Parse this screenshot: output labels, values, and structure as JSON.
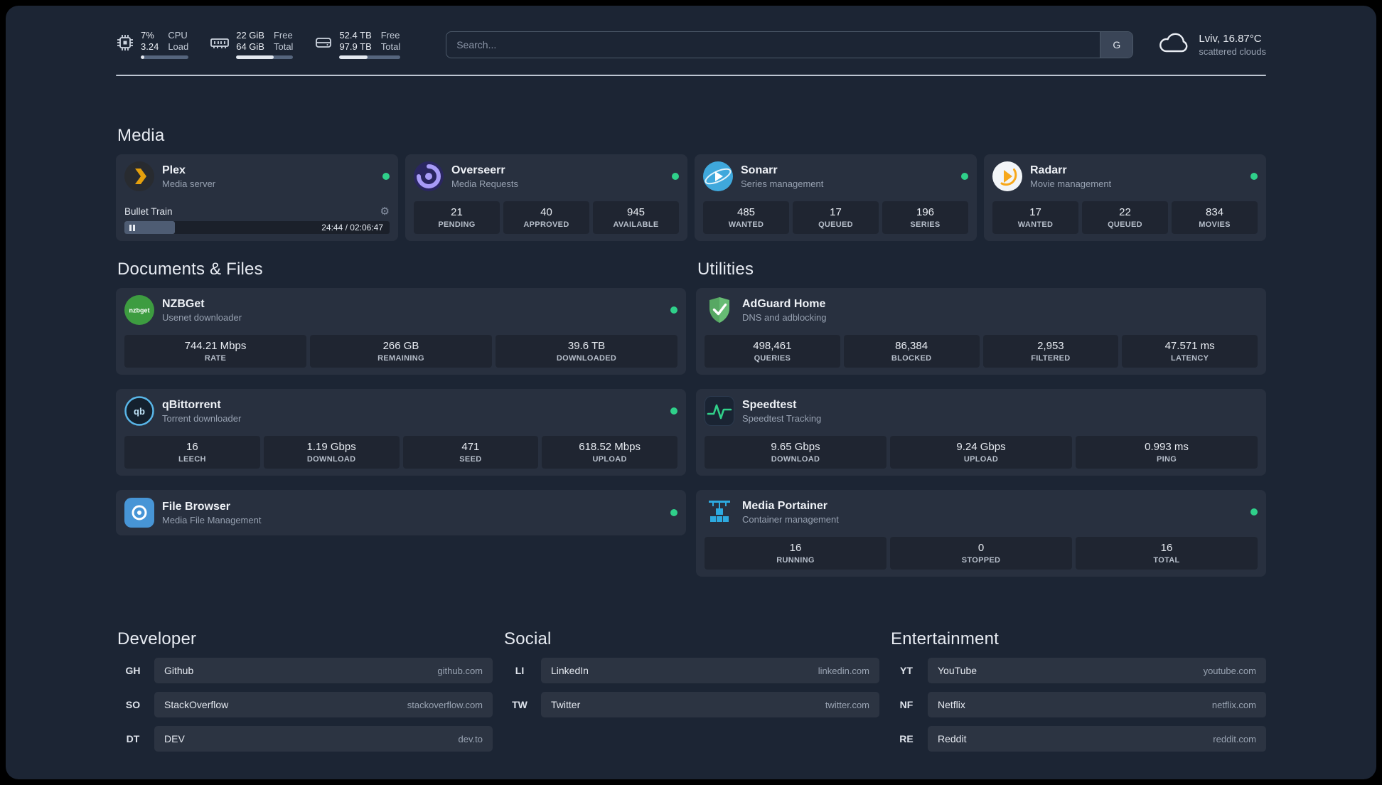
{
  "topbar": {
    "resources": [
      {
        "icon": "cpu-icon",
        "values": [
          "7%",
          "3.24"
        ],
        "labels": [
          "CPU",
          "Load"
        ],
        "progress": 7
      },
      {
        "icon": "memory-icon",
        "values": [
          "22 GiB",
          "64 GiB"
        ],
        "labels": [
          "Free",
          "Total"
        ],
        "progress": 66
      },
      {
        "icon": "disk-icon",
        "values": [
          "52.4 TB",
          "97.9 TB"
        ],
        "labels": [
          "Free",
          "Total"
        ],
        "progress": 46
      }
    ],
    "search": {
      "placeholder": "Search...",
      "provider_label": "G"
    },
    "weather": {
      "location": "Lviv, 16.87°C",
      "condition": "scattered clouds"
    }
  },
  "groups": {
    "media": {
      "title": "Media",
      "cards": [
        {
          "name": "Plex",
          "desc": "Media server",
          "icon": "plex-icon",
          "status": "online",
          "player": {
            "track": "Bullet Train",
            "time": "24:44 / 02:06:47",
            "progress": 19
          }
        },
        {
          "name": "Overseerr",
          "desc": "Media Requests",
          "icon": "overseerr-icon",
          "status": "online",
          "stats": [
            {
              "value": "21",
              "label": "PENDING"
            },
            {
              "value": "40",
              "label": "APPROVED"
            },
            {
              "value": "945",
              "label": "AVAILABLE"
            }
          ]
        },
        {
          "name": "Sonarr",
          "desc": "Series management",
          "icon": "sonarr-icon",
          "status": "online",
          "stats": [
            {
              "value": "485",
              "label": "WANTED"
            },
            {
              "value": "17",
              "label": "QUEUED"
            },
            {
              "value": "196",
              "label": "SERIES"
            }
          ]
        },
        {
          "name": "Radarr",
          "desc": "Movie management",
          "icon": "radarr-icon",
          "status": "online",
          "stats": [
            {
              "value": "17",
              "label": "WANTED"
            },
            {
              "value": "22",
              "label": "QUEUED"
            },
            {
              "value": "834",
              "label": "MOVIES"
            }
          ]
        }
      ]
    },
    "documents": {
      "title": "Documents & Files",
      "cards": [
        {
          "name": "NZBGet",
          "desc": "Usenet downloader",
          "icon": "nzbget-icon",
          "status": "online",
          "stats": [
            {
              "value": "744.21 Mbps",
              "label": "RATE"
            },
            {
              "value": "266 GB",
              "label": "REMAINING"
            },
            {
              "value": "39.6 TB",
              "label": "DOWNLOADED"
            }
          ]
        },
        {
          "name": "qBittorrent",
          "desc": "Torrent downloader",
          "icon": "qbittorrent-icon",
          "status": "online",
          "stats": [
            {
              "value": "16",
              "label": "LEECH"
            },
            {
              "value": "1.19 Gbps",
              "label": "DOWNLOAD"
            },
            {
              "value": "471",
              "label": "SEED"
            },
            {
              "value": "618.52 Mbps",
              "label": "UPLOAD"
            }
          ]
        },
        {
          "name": "File Browser",
          "desc": "Media File Management",
          "icon": "filebrowser-icon",
          "status": "online"
        }
      ]
    },
    "utilities": {
      "title": "Utilities",
      "cards": [
        {
          "name": "AdGuard Home",
          "desc": "DNS and adblocking",
          "icon": "adguard-icon",
          "stats": [
            {
              "value": "498,461",
              "label": "QUERIES"
            },
            {
              "value": "86,384",
              "label": "BLOCKED"
            },
            {
              "value": "2,953",
              "label": "FILTERED"
            },
            {
              "value": "47.571 ms",
              "label": "LATENCY"
            }
          ]
        },
        {
          "name": "Speedtest",
          "desc": "Speedtest Tracking",
          "icon": "speedtest-icon",
          "stats": [
            {
              "value": "9.65 Gbps",
              "label": "DOWNLOAD"
            },
            {
              "value": "9.24 Gbps",
              "label": "UPLOAD"
            },
            {
              "value": "0.993 ms",
              "label": "PING"
            }
          ]
        },
        {
          "name": "Media Portainer",
          "desc": "Container management",
          "icon": "portainer-icon",
          "status": "online",
          "stats": [
            {
              "value": "16",
              "label": "RUNNING"
            },
            {
              "value": "0",
              "label": "STOPPED"
            },
            {
              "value": "16",
              "label": "TOTAL"
            }
          ]
        }
      ]
    }
  },
  "bookmarks": [
    {
      "title": "Developer",
      "items": [
        {
          "abbr": "GH",
          "name": "Github",
          "domain": "github.com"
        },
        {
          "abbr": "SO",
          "name": "StackOverflow",
          "domain": "stackoverflow.com"
        },
        {
          "abbr": "DT",
          "name": "DEV",
          "domain": "dev.to"
        }
      ]
    },
    {
      "title": "Social",
      "items": [
        {
          "abbr": "LI",
          "name": "LinkedIn",
          "domain": "linkedin.com"
        },
        {
          "abbr": "TW",
          "name": "Twitter",
          "domain": "twitter.com"
        }
      ]
    },
    {
      "title": "Entertainment",
      "items": [
        {
          "abbr": "YT",
          "name": "YouTube",
          "domain": "youtube.com"
        },
        {
          "abbr": "NF",
          "name": "Netflix",
          "domain": "netflix.com"
        },
        {
          "abbr": "RE",
          "name": "Reddit",
          "domain": "reddit.com"
        }
      ]
    }
  ],
  "colors": {
    "status_online": "#2fd08a",
    "accent_green": "#31d08a",
    "plex_amber": "#e5a00d",
    "background": "#1c2534"
  }
}
